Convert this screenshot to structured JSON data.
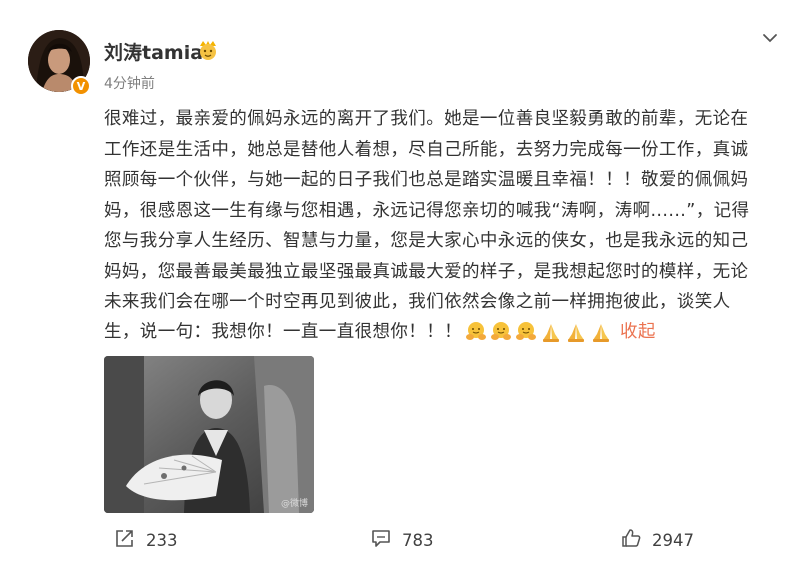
{
  "post": {
    "username": "刘涛tamia",
    "timestamp": "4分钟前",
    "verified_badge": "V",
    "badge_icon": "fan-medal-icon",
    "body": "很难过，最亲爱的佩妈永远的离开了我们。她是一位善良坚毅勇敢的前辈，无论在\n工作还是生活中，她总是替他人着想，尽自己所能，去努力完成每一份工作，真诚\n照顾每一个伙伴，与她一起的日子我们也总是踏实温暖且幸福！！！敬爱的佩佩妈\n妈，很感恩这一生有缘与您相遇，永远记得您亲切的喊我“涛啊，涛啊......”，记得\n您与我分享人生经历、智慧与力量，您是大家心中永远的侠女，也是我永远的知己\n妈妈，您最善最美最独立最坚强最真诚最大爱的样子，是我想起您时的模样，无论\n未来我们会在哪一个时空再见到彼此，我们依然会像之前一样拥抱彼此，谈笑人",
    "body_tail": "生，说一句：我想你！一直一直很想你！！！",
    "emojis": [
      "hug-icon",
      "hug-icon",
      "hug-icon",
      "pray-icon",
      "pray-icon",
      "pray-icon"
    ],
    "collapse_label": "收起",
    "photo_watermark": "@微博"
  },
  "actions": {
    "share_count": "233",
    "comment_count": "783",
    "like_count": "2947"
  },
  "colors": {
    "text": "#333333",
    "muted": "#808080",
    "link": "#eb7350",
    "verified": "#f29100"
  }
}
